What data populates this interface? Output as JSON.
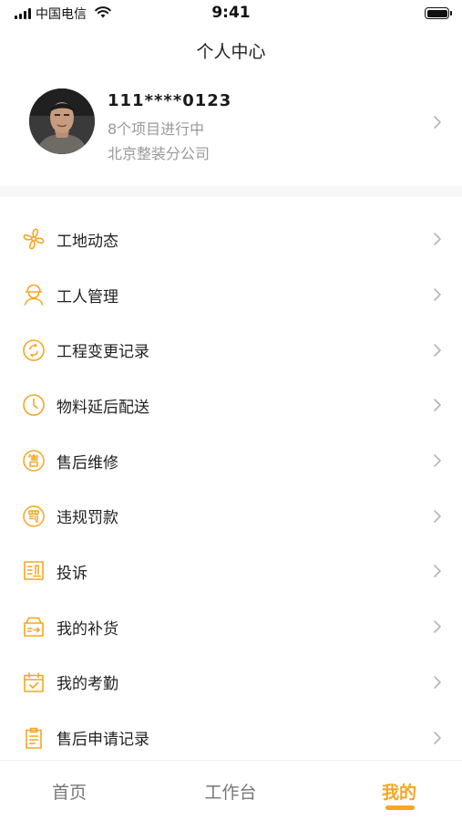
{
  "status_bar": {
    "carrier": "中国电信",
    "time": "9:41"
  },
  "nav": {
    "title": "个人中心"
  },
  "profile": {
    "phone": "111****0123",
    "projects": "8个项目进行中",
    "company": "北京整装分公司"
  },
  "menu": {
    "items": [
      {
        "label": "工地动态",
        "icon": "fan-icon"
      },
      {
        "label": "工人管理",
        "icon": "worker-icon"
      },
      {
        "label": "工程变更记录",
        "icon": "refresh-icon"
      },
      {
        "label": "物料延后配送",
        "icon": "clock-icon"
      },
      {
        "label": "售后维修",
        "icon": "after-sale-icon"
      },
      {
        "label": "违规罚款",
        "icon": "fine-icon"
      },
      {
        "label": "投诉",
        "icon": "complaint-icon"
      },
      {
        "label": "我的补货",
        "icon": "restock-icon"
      },
      {
        "label": "我的考勤",
        "icon": "calendar-check-icon"
      },
      {
        "label": "售后申请记录",
        "icon": "clipboard-icon"
      }
    ]
  },
  "tabbar": {
    "home": "首页",
    "work": "工作台",
    "mine": "我的"
  },
  "colors": {
    "accent": "#f5a623",
    "text": "#222222",
    "secondary_text": "#999999"
  }
}
